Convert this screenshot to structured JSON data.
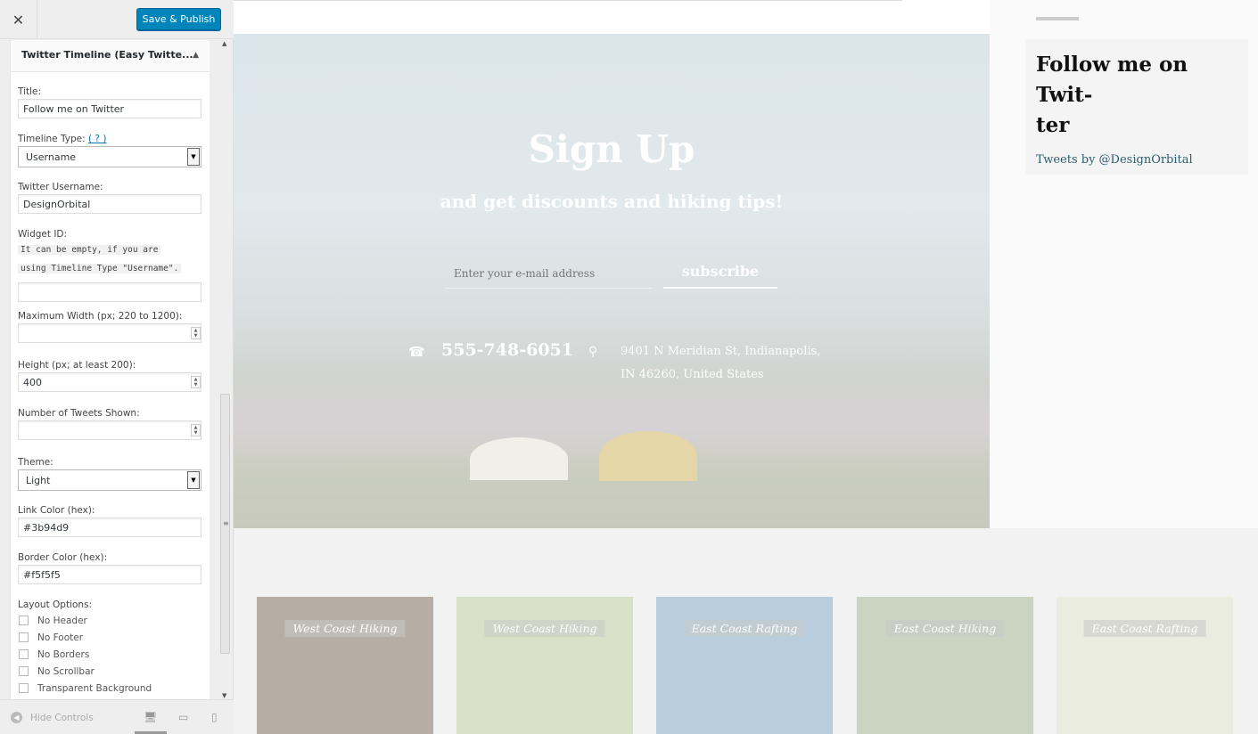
{
  "header": {
    "close_icon": "close-icon",
    "publish_label": "Save & Publish"
  },
  "widget": {
    "title": "Twitter Timeline (Easy Twitte...",
    "toggle_icon": "triangle-up-icon"
  },
  "fields": {
    "title": {
      "label": "Title:",
      "value": "Follow me on Twitter"
    },
    "timeline_type": {
      "label": "Timeline Type:",
      "help": "( ? )",
      "value": "Username"
    },
    "username": {
      "label": "Twitter Username:",
      "value": "DesignOrbital"
    },
    "widget_id": {
      "label": "Widget ID:",
      "note_line1": "It can be empty, if you are",
      "note_line2": "using Timeline Type \"Username\".",
      "value": ""
    },
    "max_width": {
      "label": "Maximum Width (px; 220 to 1200):",
      "value": ""
    },
    "height": {
      "label": "Height (px; at least 200):",
      "value": "400"
    },
    "num_tweets": {
      "label": "Number of Tweets Shown:",
      "value": ""
    },
    "theme": {
      "label": "Theme:",
      "value": "Light"
    },
    "link_color": {
      "label": "Link Color (hex):",
      "value": "#3b94d9"
    },
    "border_color": {
      "label": "Border Color (hex):",
      "value": "#f5f5f5"
    },
    "layout": {
      "label": "Layout Options:",
      "options": [
        "No Header",
        "No Footer",
        "No Borders",
        "No Scrollbar",
        "Transparent Background"
      ]
    }
  },
  "footer": {
    "hide_label": "Hide Controls",
    "devices": [
      "desktop-icon",
      "tablet-icon",
      "mobile-icon"
    ]
  },
  "preview": {
    "hero": {
      "title": "Sign Up",
      "subtitle": "and get discounts and hiking tips!",
      "email_placeholder": "Enter your e-mail address",
      "subscribe_label": "subscribe",
      "phone": "555-748-6051",
      "address_line1": "9401 N Meridian St, Indianapolis,",
      "address_line2": "IN 46260, United States"
    },
    "twitter": {
      "title_line1": "Follow me on Twit-",
      "title_line2": "ter",
      "link": "Tweets by @DesignOrbital"
    },
    "cards": [
      {
        "label": "West Coast Hiking",
        "color": "#7a6a5a"
      },
      {
        "label": "West Coast Hiking",
        "color": "#b9c89a"
      },
      {
        "label": "East Coast Rafting",
        "color": "#7fa6c4"
      },
      {
        "label": "East Coast Hiking",
        "color": "#9fb18c"
      },
      {
        "label": "East Coast Rafting",
        "color": "#d8dcc4"
      }
    ]
  }
}
